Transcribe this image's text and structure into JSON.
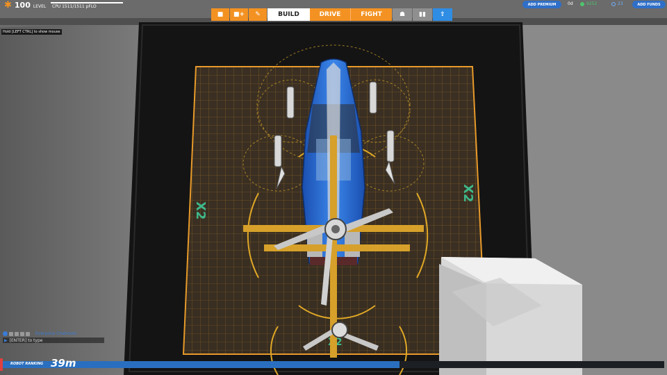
{
  "player": {
    "level": "100",
    "level_unit": "LEVEL",
    "cpu": "CPU 1511/1511 pFLO",
    "level_progress": 1.0
  },
  "tabs": {
    "icon_tabs": [
      "cube-icon",
      "cube-plus-icon",
      "paint-icon"
    ],
    "build": "BUILD",
    "drive": "DRIVE",
    "fight": "FIGHT",
    "right_icons": [
      "players-icon",
      "stats-icon",
      "share-icon"
    ]
  },
  "hud": {
    "add_premium": "ADD PREMIUM",
    "premium_days": "0d",
    "robits": "9252",
    "galaxy_credits": "23",
    "add_funds": "ADD FUNDS"
  },
  "hint": "Hold [LEFT CTRL] to show mouse",
  "chat": {
    "channel_name": "Everyone Chatroom",
    "input_placeholder": "[ENTER] to type"
  },
  "grid": {
    "label_left": "X2",
    "label_right": "X2",
    "label_bottom": "X2"
  },
  "ranking": {
    "label": "ROBOT RANKING",
    "value": "39m",
    "progress": 0.6
  },
  "colors": {
    "accent_orange": "#f39222",
    "accent_blue": "#2f8de4",
    "robits_green": "#4ec46d",
    "grid_gold": "#d49a2a",
    "hull_blue": "#2b6fd4"
  }
}
